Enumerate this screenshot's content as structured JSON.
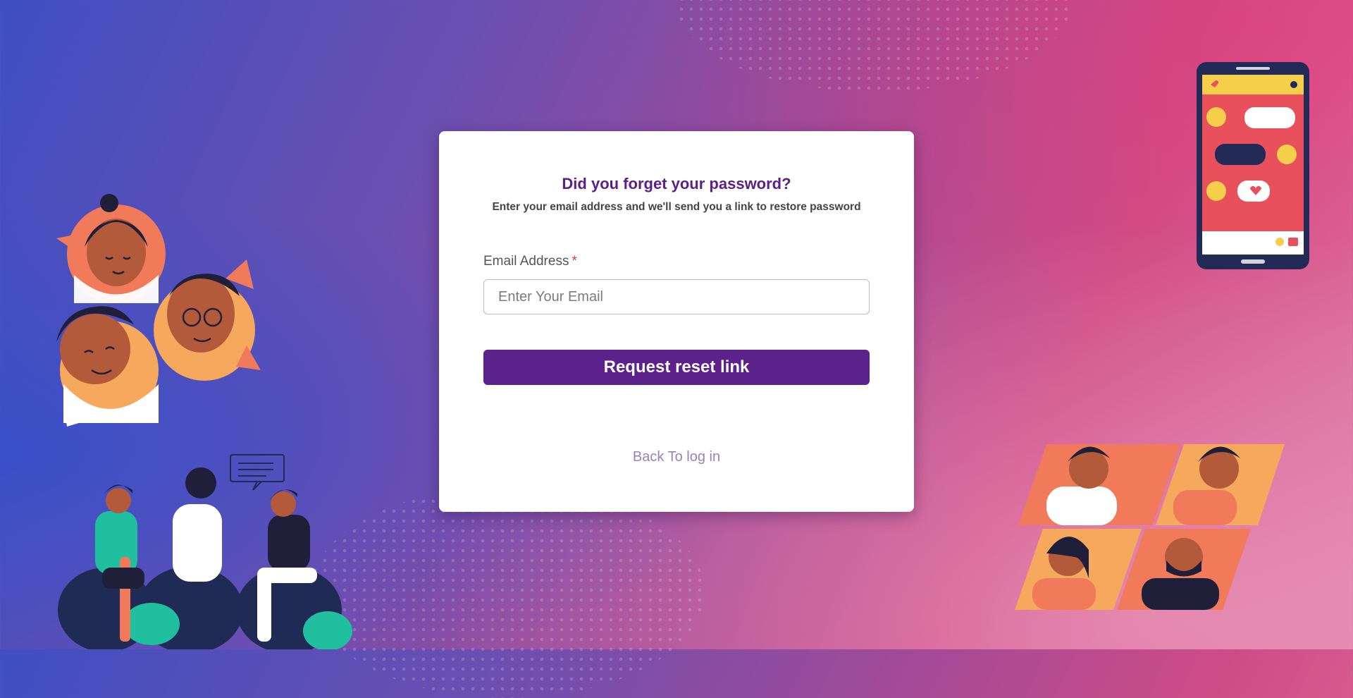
{
  "card": {
    "title": "Did you forget your password?",
    "subtitle": "Enter your email address and we'll send you a link to restore password",
    "email_label": "Email Address",
    "required_marker": "*",
    "email_placeholder": "Enter Your Email",
    "email_value": "",
    "submit_label": "Request reset link",
    "back_link_label": "Back To log in"
  },
  "colors": {
    "brand_purple": "#5c218a",
    "title_purple": "#5b1f86",
    "link_color": "#9b82b5",
    "required_red": "#d43c3c"
  },
  "illustrations": [
    "people-avatars-illustration",
    "group-chatting-illustration",
    "phone-chat-illustration",
    "video-call-grid-illustration"
  ]
}
